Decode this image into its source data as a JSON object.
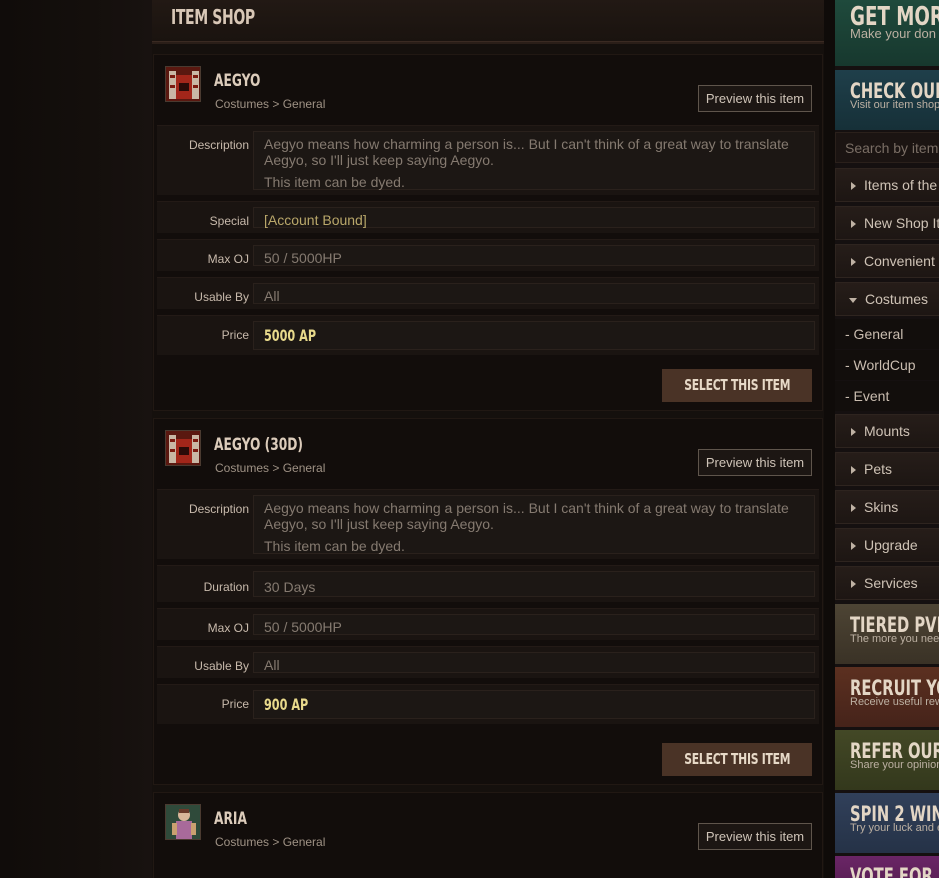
{
  "page_title": "ITEM SHOP",
  "items": [
    {
      "name": "AEGYO",
      "category": "Costumes > General",
      "preview_label": "Preview this item",
      "rows": {
        "description_label": "Description",
        "description_text": "Aegyo means how charming a person is... But I can't think of a great way to translate Aegyo, so I'll just keep saying Aegyo.",
        "description_note": "This item can be dyed.",
        "special_label": "Special",
        "special_value": "[Account Bound]",
        "maxoj_label": "Max OJ",
        "maxoj_value": "50 / 5000HP",
        "usable_label": "Usable By",
        "usable_value": "All",
        "price_label": "Price",
        "price_value": "5000 AP"
      },
      "select_label": "SELECT THIS ITEM"
    },
    {
      "name": "AEGYO (30D)",
      "category": "Costumes > General",
      "preview_label": "Preview this item",
      "rows": {
        "description_label": "Description",
        "description_text": "Aegyo means how charming a person is... But I can't think of a great way to translate Aegyo, so I'll just keep saying Aegyo.",
        "description_note": "This item can be dyed.",
        "duration_label": "Duration",
        "duration_value": "30 Days",
        "maxoj_label": "Max OJ",
        "maxoj_value": "50 / 5000HP",
        "usable_label": "Usable By",
        "usable_value": "All",
        "price_label": "Price",
        "price_value": "900 AP"
      },
      "select_label": "SELECT THIS ITEM"
    },
    {
      "name": "ARIA",
      "category": "Costumes > General",
      "preview_label": "Preview this item"
    }
  ],
  "sidebar": {
    "banner_get_more": {
      "title": "GET MOR",
      "subtitle": "Make your don",
      "color": "#1f4a3c"
    },
    "banner_check": {
      "title": "CHECK OUR IT",
      "subtitle": "Visit our item shop",
      "color": "#1d3a44"
    },
    "search_placeholder": "Search by item",
    "menu": [
      {
        "label": "Items of the",
        "open": false
      },
      {
        "label": "New Shop It",
        "open": false
      },
      {
        "label": "Convenient",
        "open": false
      },
      {
        "label": "Costumes",
        "open": true
      }
    ],
    "submenu": [
      "- General",
      "- WorldCup",
      "- Event"
    ],
    "menu2": [
      {
        "label": "Mounts"
      },
      {
        "label": "Pets"
      },
      {
        "label": "Skins"
      },
      {
        "label": "Upgrade"
      },
      {
        "label": "Services"
      }
    ],
    "banners": [
      {
        "title": "TIERED PVP R",
        "subtitle": "The more you nee",
        "color": "#4b4233"
      },
      {
        "title": "RECRUIT YOU",
        "subtitle": "Receive useful rew",
        "color": "#5a2e1f"
      },
      {
        "title": "REFER OUR S",
        "subtitle": "Share your opinion",
        "color": "#3f4424"
      },
      {
        "title": "SPIN 2 WIN",
        "subtitle": "Try your luck and e",
        "color": "#2e3b4e"
      },
      {
        "title": "VOTE FOR US",
        "subtitle": "",
        "color": "#5a1f55"
      }
    ]
  }
}
